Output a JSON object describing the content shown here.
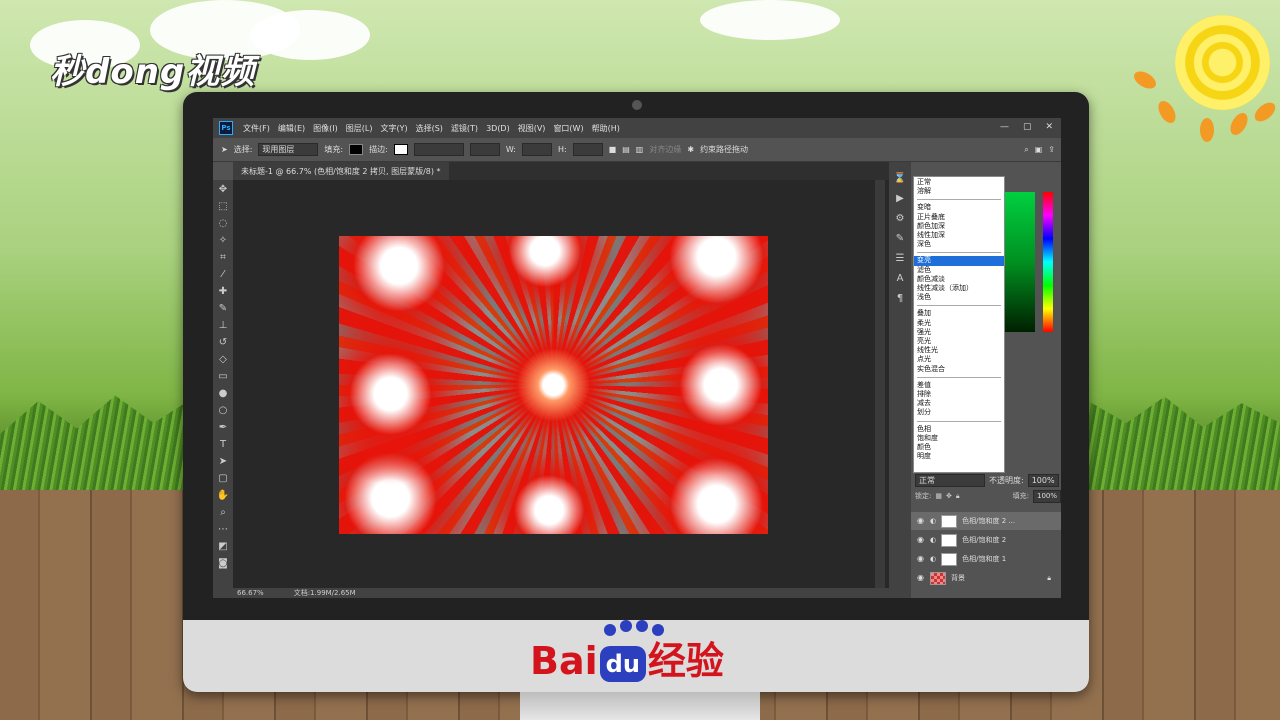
{
  "watermark": {
    "logo_text": "秒dong视频"
  },
  "brand": {
    "baidu_left": "Bai",
    "baidu_du": "du",
    "baidu_right": "经验"
  },
  "app": {
    "logo": "Ps",
    "menu": [
      "文件(F)",
      "编辑(E)",
      "图像(I)",
      "图层(L)",
      "文字(Y)",
      "选择(S)",
      "滤镜(T)",
      "3D(D)",
      "视图(V)",
      "窗口(W)",
      "帮助(H)"
    ],
    "window_controls": [
      "—",
      "▢",
      "✕"
    ]
  },
  "options_bar": {
    "select_label": "选择:",
    "select_value": "现用图层",
    "fill_label": "填充:",
    "stroke_label": "描边:",
    "w_label": "W:",
    "h_label": "H:",
    "align_edges": "对齐边缘",
    "constrain_path": "约束路径拖动"
  },
  "document": {
    "tab_title": "未标题-1 @ 66.7% (色相/饱和度 2 拷贝, 图层蒙版/8) *",
    "zoom": "66.67%",
    "doc_info": "文档:1.99M/2.65M"
  },
  "blend_menu": {
    "groups": [
      [
        "正常",
        "溶解"
      ],
      [
        "变暗",
        "正片叠底",
        "颜色加深",
        "线性加深",
        "深色"
      ],
      [
        "变亮",
        "滤色",
        "颜色减淡",
        "线性减淡（添加）",
        "浅色"
      ],
      [
        "叠加",
        "柔光",
        "强光",
        "亮光",
        "线性光",
        "点光",
        "实色混合"
      ],
      [
        "差值",
        "排除",
        "减去",
        "划分"
      ],
      [
        "色相",
        "饱和度",
        "颜色",
        "明度"
      ]
    ],
    "highlighted": "变亮"
  },
  "layers_panel": {
    "blend_mode": "正常",
    "opacity_label": "不透明度:",
    "opacity_value": "100%",
    "lock_label": "锁定:",
    "fill_label": "填充:",
    "fill_value": "100%",
    "layers": [
      {
        "name": "色相/饱和度 2 ..."
      },
      {
        "name": "色相/饱和度 2"
      },
      {
        "name": "色相/饱和度 1"
      },
      {
        "name": "背景"
      }
    ]
  },
  "colors": {
    "ps_blue": "#31a8ff",
    "highlight": "#1e6fd9",
    "baidu_red": "#d4141c",
    "baidu_blue": "#2b3fbf"
  }
}
